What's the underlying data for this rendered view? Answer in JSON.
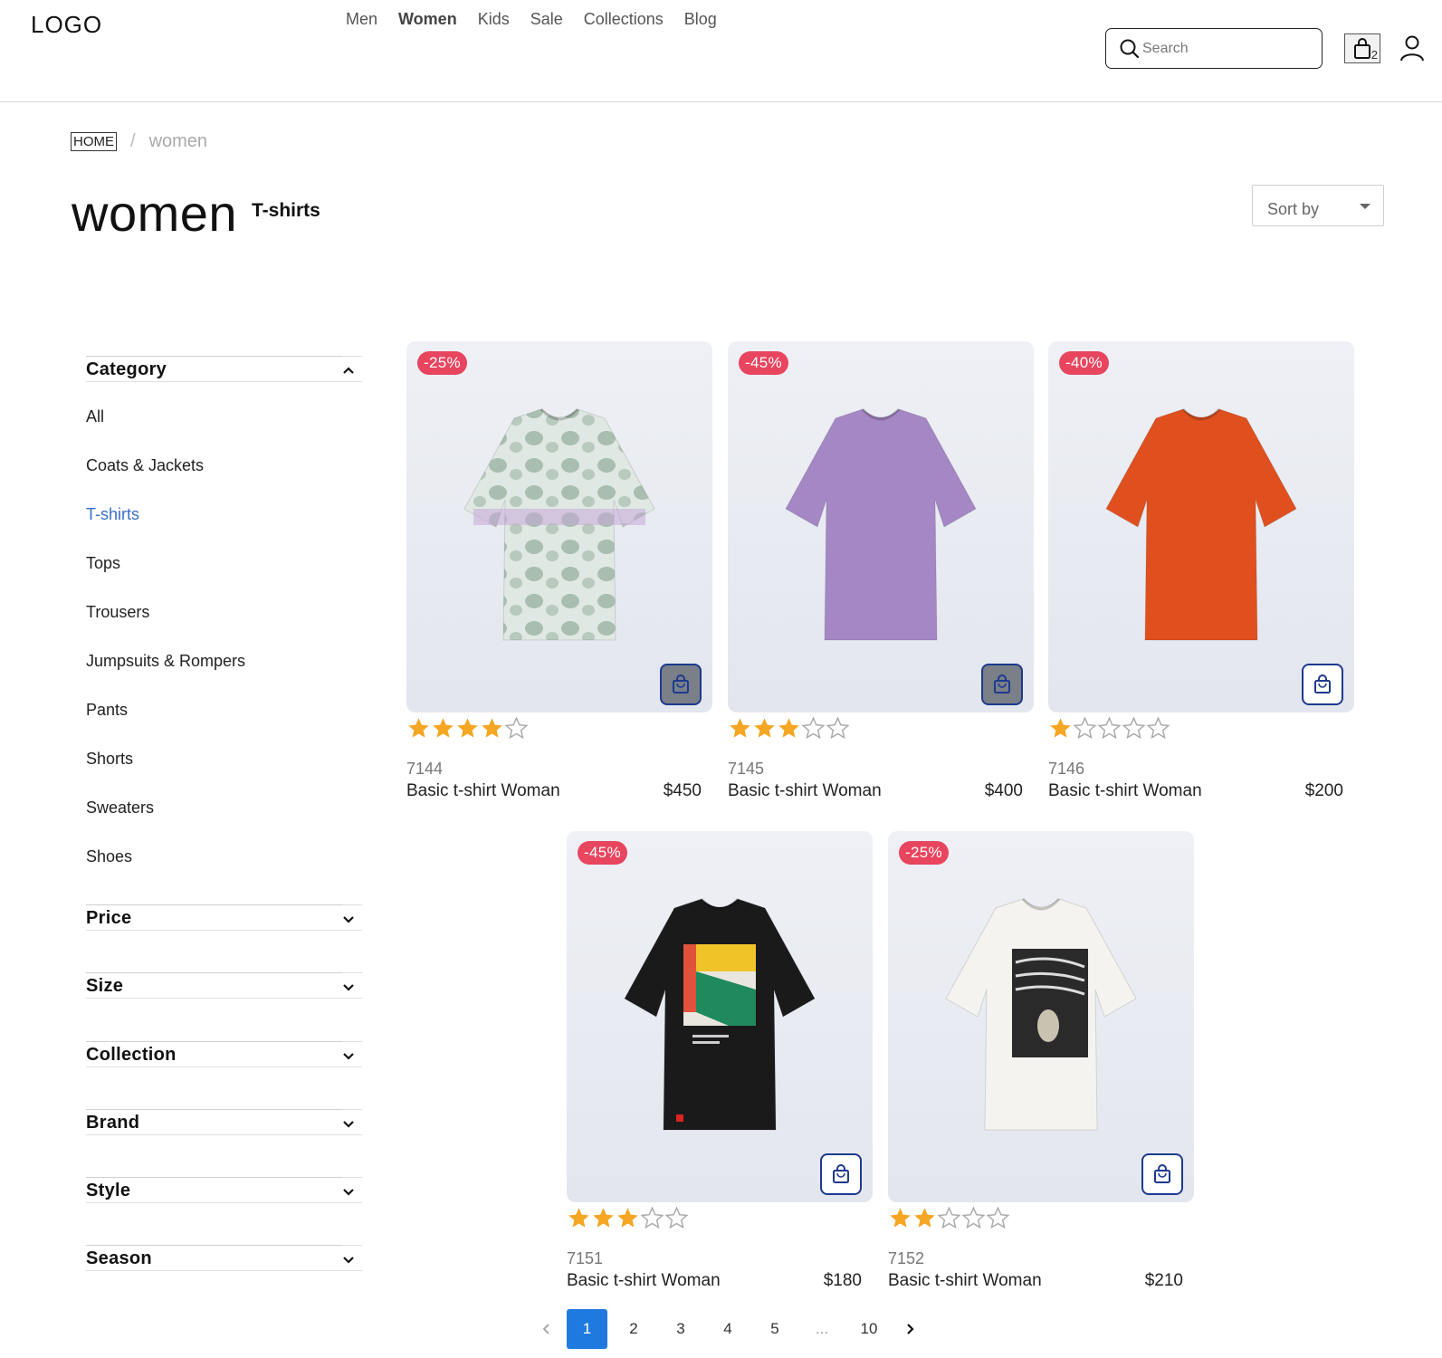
{
  "header": {
    "logo": "LOGO",
    "nav": [
      "Men",
      "Women",
      "Kids",
      "Sale",
      "Collections",
      "Blog"
    ],
    "active_nav": "Women",
    "search_placeholder": "Search",
    "cart_count": "2"
  },
  "breadcrumb": {
    "home": "HOME",
    "separator": "/",
    "current": "women"
  },
  "page": {
    "title": "women",
    "subtitle": "T-shirts",
    "sort_label": "Sort by"
  },
  "filters": {
    "category": {
      "title": "Category",
      "items": [
        "All",
        "Coats & Jackets",
        "T-shirts",
        "Tops",
        "Trousers",
        "Jumpsuits & Rompers",
        "Pants",
        "Shorts",
        "Sweaters",
        "Shoes"
      ],
      "active": "T-shirts"
    },
    "others": [
      "Price",
      "Size",
      "Collection",
      "Brand",
      "Style",
      "Season"
    ]
  },
  "products": [
    {
      "sku": "7144",
      "name": "Basic t-shirt Woman",
      "price": "$450",
      "discount": "-25%",
      "rating": 4,
      "color": "tie-dye",
      "bag_style": "dark"
    },
    {
      "sku": "7145",
      "name": "Basic t-shirt Woman",
      "price": "$400",
      "discount": "-45%",
      "rating": 3,
      "color": "#a487c4",
      "bag_style": "dark"
    },
    {
      "sku": "7146",
      "name": "Basic t-shirt Woman",
      "price": "$200",
      "discount": "-40%",
      "rating": 1,
      "color": "#e0501e",
      "bag_style": "light"
    },
    {
      "sku": "7151",
      "name": "Basic t-shirt Woman",
      "price": "$180",
      "discount": "-45%",
      "rating": 3,
      "color": "#1a1a1a",
      "bag_style": "light"
    },
    {
      "sku": "7152",
      "name": "Basic t-shirt Woman",
      "price": "$210",
      "discount": "-25%",
      "rating": 2,
      "color": "#f4f3ef",
      "bag_style": "light"
    }
  ],
  "pagination": {
    "pages": [
      "1",
      "2",
      "3",
      "4",
      "5",
      "...",
      "10"
    ],
    "active": "1"
  },
  "colors": {
    "accent": "#1f7ae0",
    "discount": "#e8455e",
    "star": "#f5a623",
    "active_category": "#3a6fc4"
  }
}
